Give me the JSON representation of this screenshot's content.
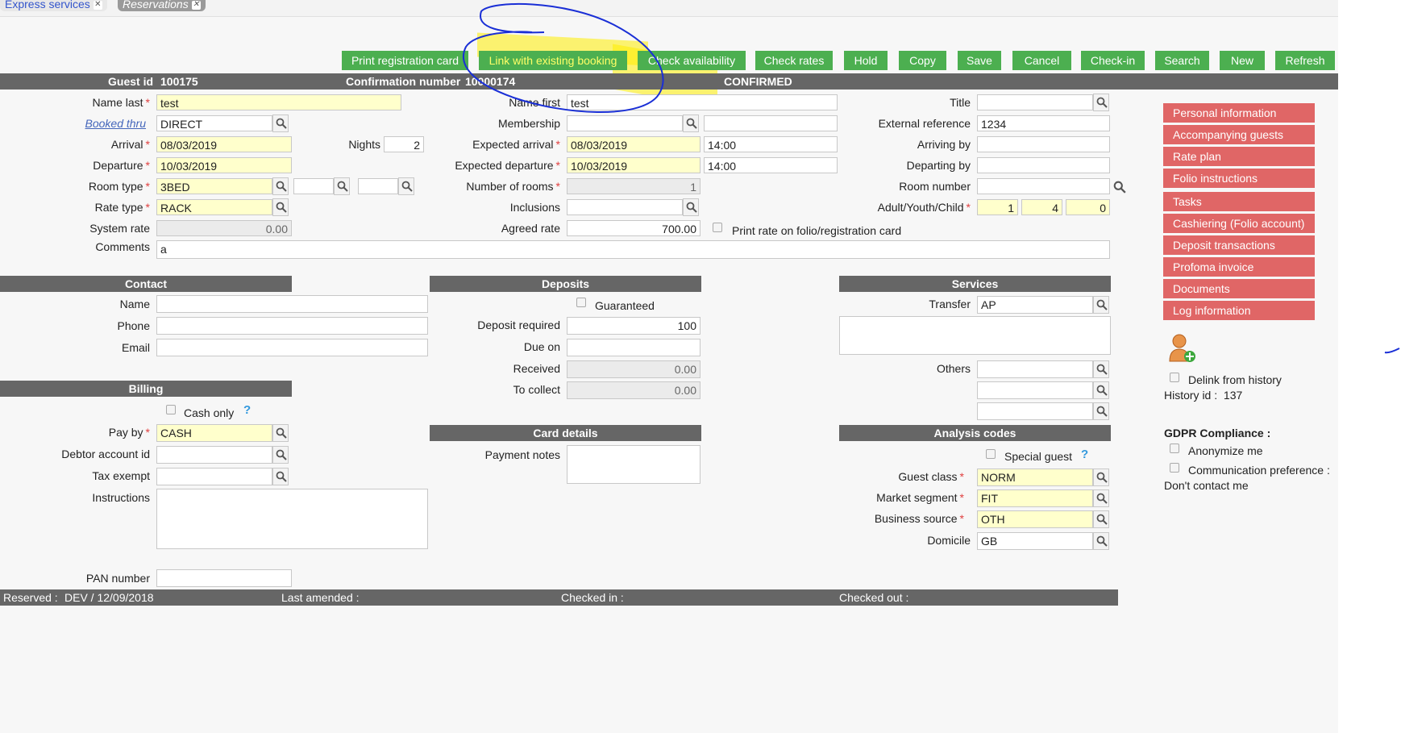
{
  "tabs": [
    "Express services",
    "Reservations"
  ],
  "toolbar": {
    "print_registration_card": "Print registration card",
    "link_existing": "Link with existing booking",
    "check_availability": "Check availability",
    "check_rates": "Check rates",
    "hold": "Hold",
    "copy": "Copy",
    "save": "Save",
    "cancel": "Cancel",
    "check_in": "Check-in",
    "search": "Search",
    "new": "New",
    "refresh": "Refresh"
  },
  "header": {
    "guest_id_label": "Guest id",
    "guest_id": "100175",
    "confirmation_label": "Confirmation number",
    "confirmation_number": "10000174",
    "status": "CONFIRMED"
  },
  "form": {
    "name_last_label": "Name last",
    "name_last": "test",
    "name_first_label": "Name first",
    "name_first": "test",
    "title_label": "Title",
    "title": "",
    "booked_thru_label": "Booked thru",
    "booked_thru": "DIRECT",
    "membership_label": "Membership",
    "membership": "",
    "membership_extra": "",
    "external_ref_label": "External reference",
    "external_ref": "1234",
    "arrival_label": "Arrival",
    "arrival": "08/03/2019",
    "nights_label": "Nights",
    "nights": "2",
    "expected_arrival_label": "Expected arrival",
    "expected_arrival": "08/03/2019",
    "expected_arrival_time": "14:00",
    "arriving_by_label": "Arriving by",
    "arriving_by": "",
    "departure_label": "Departure",
    "departure": "10/03/2019",
    "expected_departure_label": "Expected departure",
    "expected_departure": "10/03/2019",
    "expected_departure_time": "14:00",
    "departing_by_label": "Departing by",
    "departing_by": "",
    "room_type_label": "Room type",
    "room_type": "3BED",
    "number_of_rooms_label": "Number of rooms",
    "number_of_rooms": "1",
    "room_number_label": "Room number",
    "room_number": "",
    "rate_type_label": "Rate type",
    "rate_type": "RACK",
    "inclusions_label": "Inclusions",
    "inclusions": "",
    "adult_youth_child_label": "Adult/Youth/Child",
    "adults": "1",
    "youth": "4",
    "child": "0",
    "system_rate_label": "System rate",
    "system_rate": "0.00",
    "agreed_rate_label": "Agreed rate",
    "agreed_rate": "700.00",
    "print_rate_label": "Print rate on folio/registration card",
    "comments_label": "Comments",
    "comments": "a"
  },
  "contact": {
    "title": "Contact",
    "name_label": "Name",
    "name": "",
    "phone_label": "Phone",
    "phone": "",
    "email_label": "Email",
    "email": ""
  },
  "deposits": {
    "title": "Deposits",
    "guaranteed_label": "Guaranteed",
    "deposit_required_label": "Deposit required",
    "deposit_required": "100",
    "due_on_label": "Due on",
    "due_on": "",
    "received_label": "Received",
    "received": "0.00",
    "to_collect_label": "To collect",
    "to_collect": "0.00"
  },
  "services": {
    "title": "Services",
    "transfer_label": "Transfer",
    "transfer": "AP",
    "others_label": "Others"
  },
  "billing": {
    "title": "Billing",
    "cash_only_label": "Cash only",
    "pay_by_label": "Pay by",
    "pay_by": "CASH",
    "debtor_label": "Debtor account id",
    "debtor": "",
    "tax_exempt_label": "Tax exempt",
    "tax_exempt": "",
    "instructions_label": "Instructions",
    "pan_label": "PAN number",
    "pan": ""
  },
  "card": {
    "title": "Card details",
    "payment_notes_label": "Payment notes"
  },
  "analysis": {
    "title": "Analysis codes",
    "special_guest_label": "Special guest",
    "guest_class_label": "Guest class",
    "guest_class": "NORM",
    "market_segment_label": "Market segment",
    "market_segment": "FIT",
    "business_source_label": "Business source",
    "business_source": "OTH",
    "domicile_label": "Domicile",
    "domicile": "GB"
  },
  "sidebar": {
    "items": [
      "Personal information",
      "Accompanying guests",
      "Rate plan",
      "Folio instructions",
      "Tasks",
      "Cashiering (Folio account)",
      "Deposit transactions",
      "Profoma invoice",
      "Documents",
      "Log information"
    ],
    "delink_label": "Delink from history",
    "history_label": "History id :",
    "history_id": "137",
    "gdpr_title": "GDPR Compliance :",
    "anonymize_label": "Anonymize me",
    "comm_pref_label": "Communication preference :",
    "dont_contact_label": "Don't contact me"
  },
  "footer": {
    "reserved_label": "Reserved :",
    "reserved_value": "DEV / 12/09/2018",
    "last_amended_label": "Last amended :",
    "checked_in_label": "Checked in :",
    "checked_out_label": "Checked out :"
  },
  "colors": {
    "button_green": "#4caf50",
    "section_grey": "#666666",
    "required_yellow": "#ffffcc",
    "side_red": "#e06666",
    "annotation_blue": "#1a2fd6",
    "highlight_yellow": "#ffee00"
  }
}
